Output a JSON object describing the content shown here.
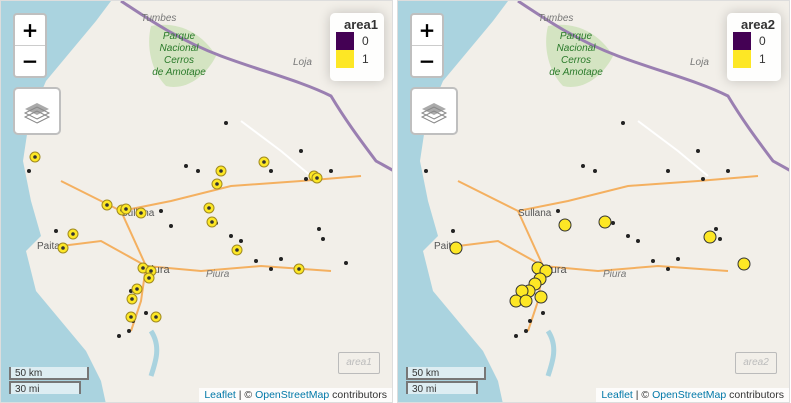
{
  "panels": [
    {
      "legend": {
        "title": "area1",
        "items": [
          {
            "label": "0",
            "color": "#440154"
          },
          {
            "label": "1",
            "color": "#FDE725"
          }
        ]
      },
      "zoom_in": "+",
      "zoom_out": "−",
      "scale_km": "50 km",
      "scale_mi": "30 mi",
      "attribution": {
        "leaflet": "Leaflet",
        "sep": " | © ",
        "osm": "OpenStreetMap",
        "tail": " contributors"
      },
      "watermark": "area1",
      "layer_icon": "layers-icon"
    },
    {
      "legend": {
        "title": "area2",
        "items": [
          {
            "label": "0",
            "color": "#440154"
          },
          {
            "label": "1",
            "color": "#FDE725"
          }
        ]
      },
      "zoom_in": "+",
      "zoom_out": "−",
      "scale_km": "50 km",
      "scale_mi": "30 mi",
      "attribution": {
        "leaflet": "Leaflet",
        "sep": " | © ",
        "osm": "OpenStreetMap",
        "tail": " contributors"
      },
      "watermark": "area2",
      "layer_icon": "layers-icon"
    }
  ],
  "map_labels": {
    "tumbes": "Tumbes",
    "park": [
      "Parque",
      "Nacional",
      "Cerros",
      "de Amotape"
    ],
    "loja": "Loja",
    "sullana": "Sullana",
    "paita": "Paita",
    "piura": "Piura",
    "piura_region": "Piura"
  },
  "colors": {
    "land": "#f2efe9",
    "sea": "#aad3df",
    "park_green": "#c8dfb0",
    "border": "#9a7fb1",
    "road_orange": "#f4b060",
    "road_white": "#ffffff"
  }
}
